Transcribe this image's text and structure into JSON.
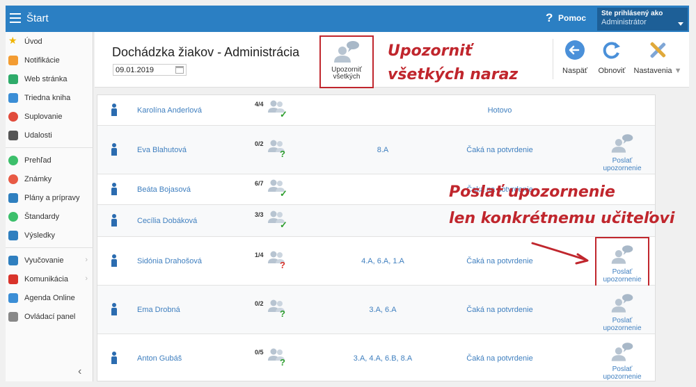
{
  "topbar": {
    "title": "Štart",
    "help_icon": "?",
    "help_label": "Pomoc",
    "user_line1": "Ste prihlásený ako",
    "user_line2": "Administrátor"
  },
  "sidebar": {
    "items": [
      {
        "label": "Úvod",
        "icon": "star-icon"
      },
      {
        "label": "Notifikácie",
        "icon": "envelope-icon"
      },
      {
        "label": "Web stránka",
        "icon": "home-icon"
      },
      {
        "label": "Triedna kniha",
        "icon": "book-icon"
      },
      {
        "label": "Suplovanie",
        "icon": "substitute-icon"
      },
      {
        "label": "Udalosti",
        "icon": "calendar-icon"
      },
      {
        "label": "Prehľad",
        "icon": "check-circle-icon"
      },
      {
        "label": "Známky",
        "icon": "grade-icon"
      },
      {
        "label": "Plány a prípravy",
        "icon": "briefcase-icon"
      },
      {
        "label": "Štandardy",
        "icon": "shield-check-icon"
      },
      {
        "label": "Výsledky",
        "icon": "bar-chart-icon"
      },
      {
        "label": "Vyučovanie",
        "icon": "teaching-icon"
      },
      {
        "label": "Komunikácia",
        "icon": "chat-icon"
      },
      {
        "label": "Agenda Online",
        "icon": "pen-icon"
      },
      {
        "label": "Ovládací panel",
        "icon": "gear-icon"
      }
    ],
    "collapse_glyph": "‹"
  },
  "header": {
    "title": "Dochádzka žiakov - Administrácia",
    "date": "09.01.2019",
    "notify_all_label": "Upozorniť všetkých",
    "back_label": "Naspäť",
    "refresh_label": "Obnoviť",
    "settings_label": "Nastavenia"
  },
  "annotations": {
    "notify_all_line1": "Upozorniť",
    "notify_all_line2": "všetkých naraz",
    "send_line1": "Poslať upozornenie",
    "send_line2": "len konkrétnemu učiteľovi"
  },
  "rows": [
    {
      "name": "Karolína Anderlová",
      "count": "4/4",
      "mark": "✓",
      "classes": "",
      "status": "Hotovo",
      "send": ""
    },
    {
      "name": "Eva Blahutová",
      "count": "0/2",
      "mark": "?",
      "classes": "8.A",
      "status": "Čaká na potvrdenie",
      "send": "Poslať upozornenie"
    },
    {
      "name": "Beáta Bojasová",
      "count": "6/7",
      "mark": "✓",
      "classes": "",
      "status": "Čaká na potvrdenie",
      "send": ""
    },
    {
      "name": "Cecília Dobáková",
      "count": "3/3",
      "mark": "✓",
      "classes": "",
      "status": "",
      "send": ""
    },
    {
      "name": "Sidónia Drahošová",
      "count": "1/4",
      "mark": "?",
      "classes": "4.A, 6.A, 1.A",
      "status": "Čaká na potvrdenie",
      "send": "Poslať upozornenie"
    },
    {
      "name": "Ema Drobná",
      "count": "0/2",
      "mark": "?",
      "classes": "3.A, 6.A",
      "status": "Čaká na potvrdenie",
      "send": "Poslať upozornenie"
    },
    {
      "name": "Anton Gubáš",
      "count": "0/5",
      "mark": "?",
      "classes": "3.A, 4.A, 6.B, 8.A",
      "status": "Čaká na potvrdenie",
      "send": "Poslať upozornenie"
    }
  ],
  "colors": {
    "topbar": "#2b7fc3",
    "user_box": "#1d5f97",
    "annotation_red": "#c0262d",
    "link_blue": "#3f7fbf",
    "check_green": "#2e9e2e",
    "question_red": "#d9342b"
  }
}
